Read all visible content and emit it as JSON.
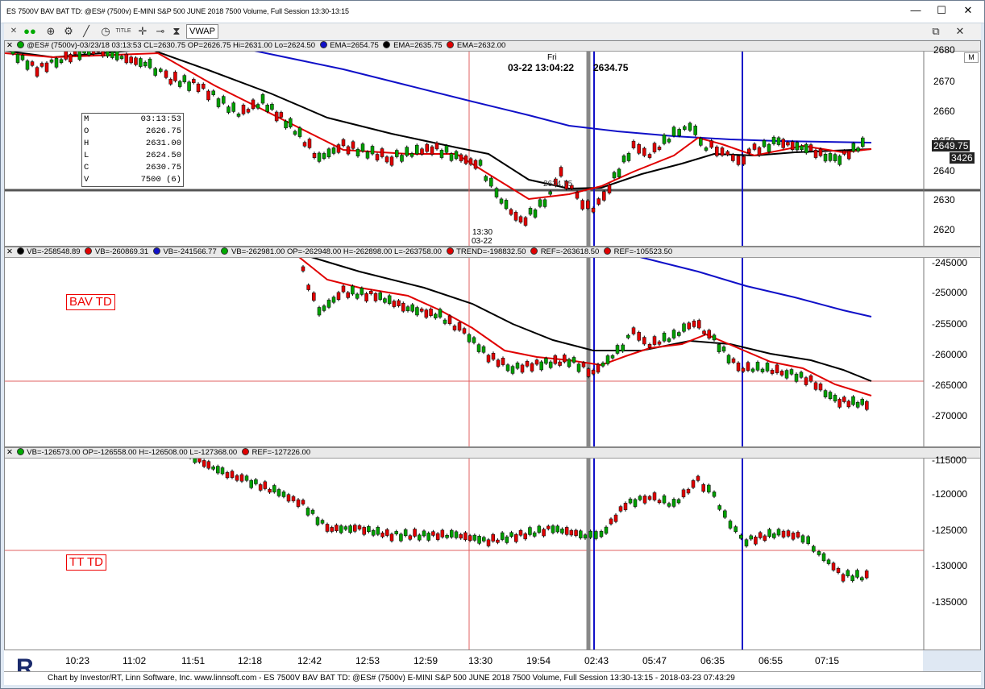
{
  "window": {
    "title": "ES 7500V BAV BAT TD: @ES# (7500v) E-MINI S&P 500 JUNE 2018 7500 Volume, Full Session 13:30-13:15",
    "minimize": "—",
    "maximize": "☐",
    "close": "✕"
  },
  "toolbar": {
    "icons": [
      "green-dots-icon",
      "zoom-icon",
      "gear-icon",
      "draw-line-icon",
      "clock-icon",
      "title-icon",
      "crosshair-icon",
      "scale-icon",
      "hourglass-icon"
    ],
    "title_label": "TITLE",
    "vwap_label": "VWAP",
    "restore_label": "⧉",
    "close_label": "✕"
  },
  "pane1": {
    "legend": {
      "symbol": "@ES# (7500v)-03/23/18 03:13:53 CL=2630.75 OP=2626.75 Hi=2631.00 Lo=2624.50",
      "ema1": "EMA=2654.75",
      "ema2": "EMA=2635.75",
      "ema3": "EMA=2632.00",
      "button": "M"
    },
    "cursor": {
      "day": "Fri",
      "time_label": "03-22 13:04:22",
      "price_label": "2634.75",
      "crosshair_label": "2634.75"
    },
    "session_label_time": "13:30",
    "session_label_date": "03-22",
    "ohlc": [
      {
        "k": "M",
        "v": "03:13:53"
      },
      {
        "k": "O",
        "v": "2626.75"
      },
      {
        "k": "H",
        "v": "2631.00"
      },
      {
        "k": "L",
        "v": "2624.50"
      },
      {
        "k": "C",
        "v": "2630.75"
      },
      {
        "k": "V",
        "v": "7500 (6)"
      }
    ],
    "axis": [
      "2680",
      "2670",
      "2660",
      "2650",
      "2640",
      "2630",
      "2620"
    ],
    "last_price": "2649.75",
    "last_volume": "3426"
  },
  "pane2": {
    "legend": {
      "vb1": "VB=-258548.89",
      "vb2": "VB=-260869.31",
      "vb3": "VB=-241566.77",
      "vb4": "VB=-262981.00 OP=-262948.00 H=-262898.00 L=-263758.00",
      "trend": "TREND=-198832.50",
      "ref1": "REF=-263618.50",
      "ref2": "REF=-105523.50",
      "button": "M"
    },
    "tag": "BAV TD",
    "axis": [
      "-245000",
      "-250000",
      "-255000",
      "-260000",
      "-265000",
      "-270000"
    ]
  },
  "pane3": {
    "legend": {
      "vb": "VB=-126573.00 OP=-126558.00 H=-126508.00 L=-127368.00",
      "ref": "REF=-127226.00",
      "button": "M"
    },
    "tag": "TT TD",
    "axis": [
      "-115000",
      "-120000",
      "-125000",
      "-130000",
      "-135000"
    ]
  },
  "time_axis": [
    "10:23",
    "11:02",
    "11:51",
    "12:18",
    "12:42",
    "12:53",
    "12:59",
    "13:30",
    "19:54",
    "02:43",
    "05:47",
    "06:35",
    "06:55",
    "07:15"
  ],
  "footer": "Chart by Investor/RT, Linn Software, Inc. www.linnsoft.com - ES 7500V BAV BAT TD: @ES# (7500v) E-MINI S&P 500 JUNE 2018 7500 Volume, Full Session 13:30-13:15 - 2018-03-23 07:43:29",
  "colors": {
    "red": "#e00000",
    "blue": "#1010c8",
    "black": "#000000",
    "green": "#00a000",
    "session_line": "#e06060"
  }
}
